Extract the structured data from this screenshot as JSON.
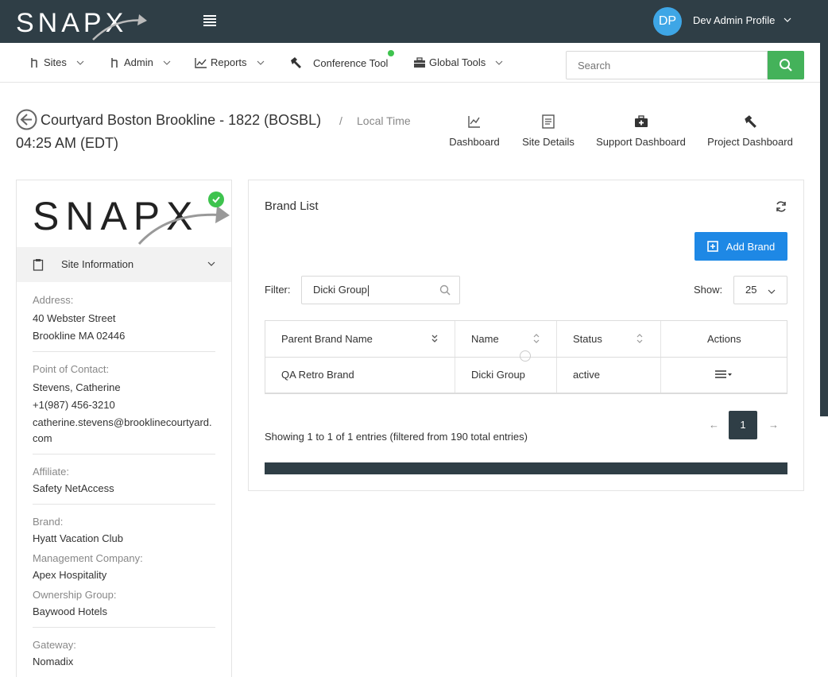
{
  "header": {
    "logo_text": "SNAPX",
    "avatar_initials": "DP",
    "profile_name": "Dev Admin Profile"
  },
  "nav": {
    "items": [
      {
        "label": "Sites",
        "icon": "sites-icon"
      },
      {
        "label": "Admin",
        "icon": "admin-icon"
      },
      {
        "label": "Reports",
        "icon": "reports-chart-icon"
      },
      {
        "label": "Conference Tool",
        "icon": "hammer-icon"
      },
      {
        "label": "Global Tools",
        "icon": "toolbox-icon"
      }
    ],
    "search_placeholder": "Search",
    "status_color": "#3ec34e"
  },
  "page": {
    "title": "Courtyard Boston Brookline - 1822 (BOSBL)",
    "separator": "/",
    "local_time_label": "Local Time",
    "local_time_value": "04:25 AM (EDT)"
  },
  "quick_links": [
    {
      "label": "Dashboard",
      "icon": "line-chart-icon"
    },
    {
      "label": "Site Details",
      "icon": "document-icon"
    },
    {
      "label": "Support Dashboard",
      "icon": "medkit-icon"
    },
    {
      "label": "Project Dashboard",
      "icon": "hammer-icon"
    }
  ],
  "site_card": {
    "logo_text": "SNAPX",
    "section_label": "Site Information",
    "address_label": "Address:",
    "address_line1": "40 Webster Street",
    "address_line2": "Brookline MA 02446",
    "contact_label": "Point of Contact:",
    "contact_name": "Stevens, Catherine",
    "contact_phone": "+1(987) 456-3210",
    "contact_email_line1": "catherine.stevens@brooklinecourtyard.",
    "contact_email_line2": "com",
    "affiliate_label": "Affiliate:",
    "affiliate_value": "Safety NetAccess",
    "brand_label": "Brand:",
    "brand_value": "Hyatt Vacation Club",
    "management_label": "Management Company:",
    "management_value": "Apex Hospitality",
    "ownership_label": "Ownership Group:",
    "ownership_value": "Baywood Hotels",
    "gateway_label": "Gateway:",
    "gateway_value": "Nomadix"
  },
  "brand_list": {
    "title": "Brand List",
    "add_button": "Add Brand",
    "filter_label": "Filter:",
    "filter_value": "Dicki Group",
    "show_label": "Show:",
    "show_value": "25",
    "columns": [
      "Parent Brand Name",
      "Name",
      "Status",
      "Actions"
    ],
    "rows": [
      {
        "parent": "QA Retro Brand",
        "name": "Dicki Group",
        "status": "active"
      }
    ],
    "showing_text": "Showing 1 to 1 of 1 entries (filtered from 190 total entries)",
    "pagination": {
      "prev": "←",
      "current": "1",
      "next": "→"
    }
  },
  "colors": {
    "header_bg": "#2f3e46",
    "accent_blue": "#1e88e5",
    "accent_green": "#44b25a",
    "avatar_blue": "#3ea6e6"
  }
}
